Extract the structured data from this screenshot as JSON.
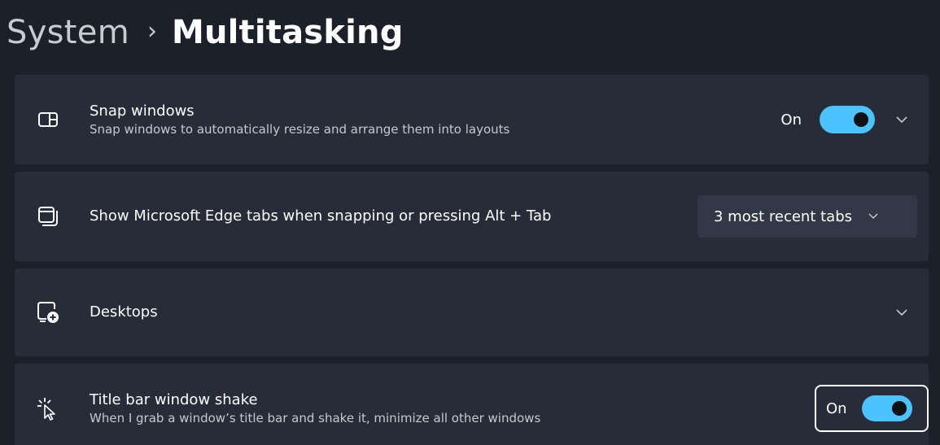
{
  "breadcrumb": {
    "parent": "System",
    "separator": "›",
    "current": "Multitasking"
  },
  "settings": [
    {
      "icon": "snap-windows-icon",
      "title": "Snap windows",
      "description": "Snap windows to automatically resize and arrange them into layouts",
      "state": "On",
      "toggle_on": true,
      "expandable": true
    },
    {
      "icon": "edge-tabs-icon",
      "title": "Show Microsoft Edge tabs when snapping or pressing Alt + Tab",
      "dropdown_value": "3 most recent tabs"
    },
    {
      "icon": "desktops-icon",
      "title": "Desktops",
      "expandable": true
    },
    {
      "icon": "window-shake-icon",
      "title": "Title bar window shake",
      "description": "When I grab a window’s title bar and shake it, minimize all other windows",
      "state": "On",
      "toggle_on": true,
      "focused": true
    }
  ],
  "colors": {
    "background": "#1c202b",
    "card": "#282c38",
    "accent": "#4cc2ff",
    "dropdown": "#333846"
  }
}
